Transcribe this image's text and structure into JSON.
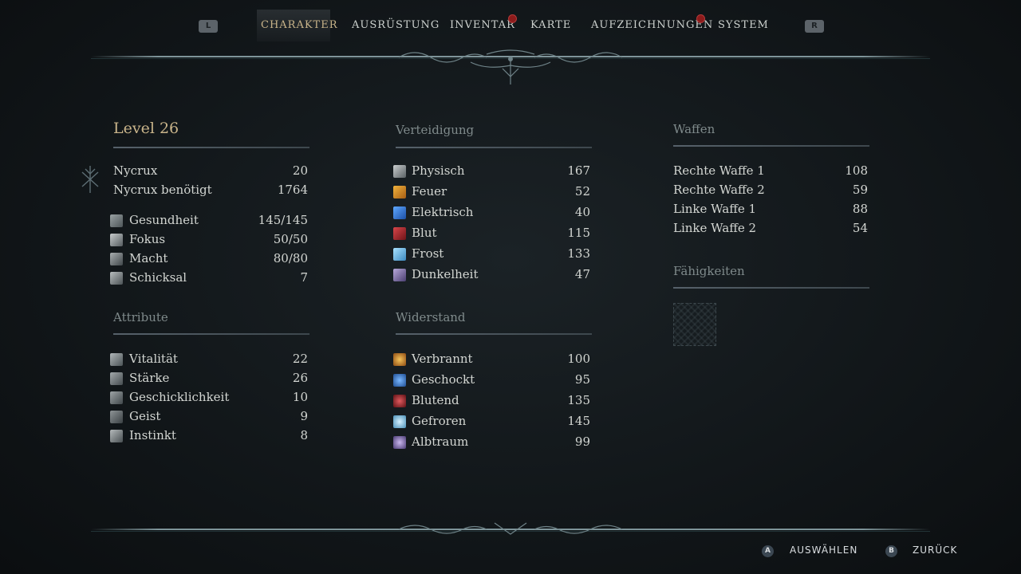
{
  "nav": {
    "left_shoulder": "L",
    "right_shoulder": "R",
    "tabs": [
      {
        "label": "CHARAKTER",
        "active": true,
        "badge": false
      },
      {
        "label": "AUSRÜSTUNG",
        "active": false,
        "badge": false
      },
      {
        "label": "INVENTAR",
        "active": false,
        "badge": true
      },
      {
        "label": "KARTE",
        "active": false,
        "badge": false
      },
      {
        "label": "AUFZEICHNUNGEN",
        "active": false,
        "badge": true
      },
      {
        "label": "SYSTEM",
        "active": false,
        "badge": false
      }
    ]
  },
  "character": {
    "level_title": "Level 26",
    "nycrux": {
      "label": "Nycrux",
      "value": "20"
    },
    "nycrux_needed": {
      "label": "Nycrux benötigt",
      "value": "1764"
    },
    "stats": [
      {
        "label": "Gesundheit",
        "value": "145/145",
        "icon": "heart-icon"
      },
      {
        "label": "Fokus",
        "value": "50/50",
        "icon": "focus-icon"
      },
      {
        "label": "Macht",
        "value": "80/80",
        "icon": "power-icon"
      },
      {
        "label": "Schicksal",
        "value": "7",
        "icon": "fate-icon"
      }
    ],
    "attributes_title": "Attribute",
    "attributes": [
      {
        "label": "Vitalität",
        "value": "22",
        "icon": "vitality-icon"
      },
      {
        "label": "Stärke",
        "value": "26",
        "icon": "strength-icon"
      },
      {
        "label": "Geschicklichkeit",
        "value": "10",
        "icon": "dexterity-icon"
      },
      {
        "label": "Geist",
        "value": "9",
        "icon": "mind-icon"
      },
      {
        "label": "Instinkt",
        "value": "8",
        "icon": "instinct-icon"
      }
    ]
  },
  "defense": {
    "title": "Verteidigung",
    "items": [
      {
        "label": "Physisch",
        "value": "167",
        "icon": "physical-icon"
      },
      {
        "label": "Feuer",
        "value": "52",
        "icon": "fire-icon"
      },
      {
        "label": "Elektrisch",
        "value": "40",
        "icon": "lightning-icon"
      },
      {
        "label": "Blut",
        "value": "115",
        "icon": "blood-icon"
      },
      {
        "label": "Frost",
        "value": "133",
        "icon": "frost-icon"
      },
      {
        "label": "Dunkelheit",
        "value": "47",
        "icon": "darkness-icon"
      }
    ]
  },
  "resistance": {
    "title": "Widerstand",
    "items": [
      {
        "label": "Verbrannt",
        "value": "100",
        "icon": "burn-icon"
      },
      {
        "label": "Geschockt",
        "value": "95",
        "icon": "shock-icon"
      },
      {
        "label": "Blutend",
        "value": "135",
        "icon": "bleed-icon"
      },
      {
        "label": "Gefroren",
        "value": "145",
        "icon": "freeze-icon"
      },
      {
        "label": "Albtraum",
        "value": "99",
        "icon": "nightmare-icon"
      }
    ]
  },
  "weapons": {
    "title": "Waffen",
    "items": [
      {
        "label": "Rechte Waffe 1",
        "value": "108"
      },
      {
        "label": "Rechte Waffe 2",
        "value": "59"
      },
      {
        "label": "Linke Waffe 1",
        "value": "88"
      },
      {
        "label": "Linke Waffe 2",
        "value": "54"
      }
    ]
  },
  "abilities": {
    "title": "Fähigkeiten"
  },
  "footer": {
    "select": {
      "button": "A",
      "label": "AUSWÄHLEN"
    },
    "back": {
      "button": "B",
      "label": "ZURÜCK"
    }
  },
  "colors": {
    "accent_gold": "#c9b48a",
    "badge_red": "#8c1b1b",
    "text": "#d3d6d2",
    "section_title": "#7f8a8b"
  }
}
